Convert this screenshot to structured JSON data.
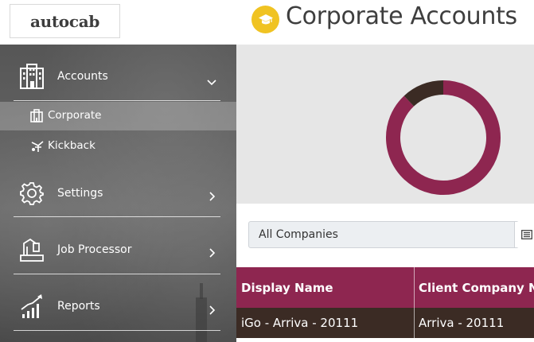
{
  "header": {
    "logo_text": "autocab",
    "page_title": "Corporate Accounts",
    "title_icon": "graduation-cap-icon",
    "title_icon_color": "#f0c322"
  },
  "sidebar": {
    "items": [
      {
        "label": "Accounts",
        "icon": "accounts-icon",
        "expanded": true
      },
      {
        "label": "Settings",
        "icon": "gear-icon"
      },
      {
        "label": "Job Processor",
        "icon": "job-processor-icon"
      },
      {
        "label": "Reports",
        "icon": "reports-chart-icon"
      }
    ],
    "sub_items": [
      {
        "label": "Corporate",
        "icon": "building-icon",
        "active": true
      },
      {
        "label": "Kickback",
        "icon": "kickback-icon"
      }
    ]
  },
  "chart_data": {
    "type": "pie",
    "style": "donut",
    "slices": [
      {
        "value": 88,
        "color": "#8e2650"
      },
      {
        "value": 12,
        "color": "#3b2b24"
      }
    ]
  },
  "filter": {
    "selected": "All Companies",
    "button_icon": "list-icon"
  },
  "table": {
    "columns": [
      "Display Name",
      "Client Company N"
    ],
    "rows": [
      [
        "iGo - Arriva - 20111",
        "Arriva - 20111"
      ]
    ],
    "header_color": "#8e2650",
    "row_color": "#3b2b24"
  }
}
